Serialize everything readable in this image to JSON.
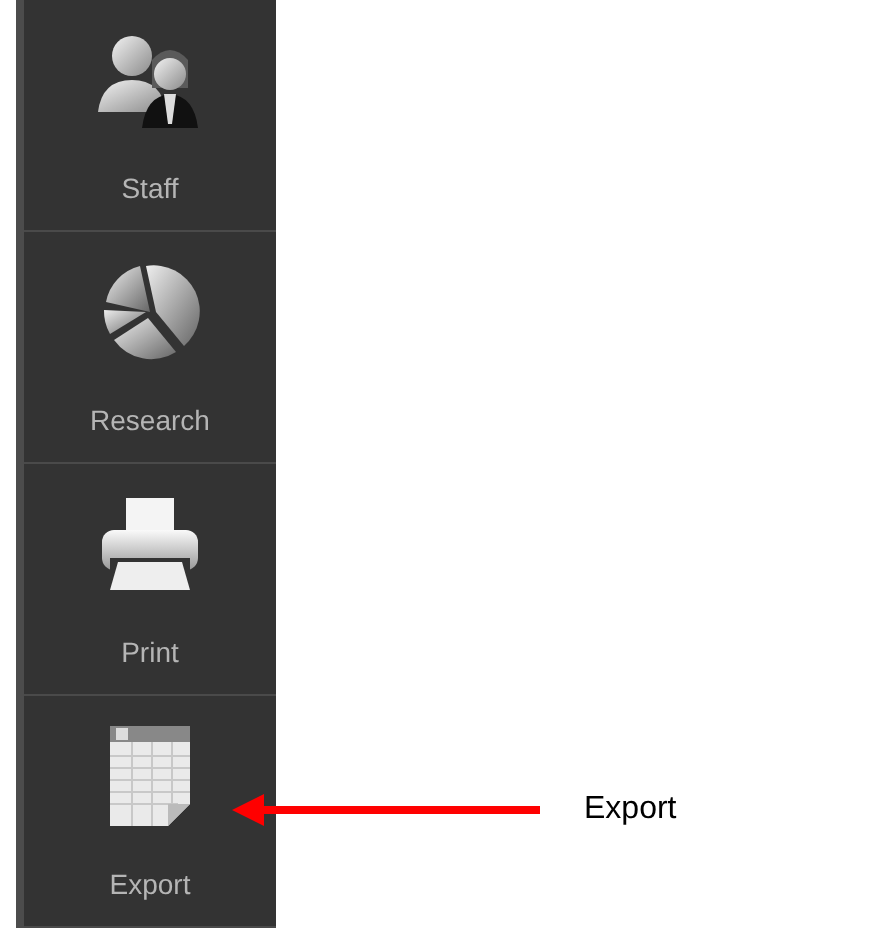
{
  "sidebar": {
    "items": [
      {
        "label": "Staff",
        "kind": "staff"
      },
      {
        "label": "Research",
        "kind": "research"
      },
      {
        "label": "Print",
        "kind": "print"
      },
      {
        "label": "Export",
        "kind": "export"
      }
    ]
  },
  "callout": {
    "label": "Export"
  }
}
